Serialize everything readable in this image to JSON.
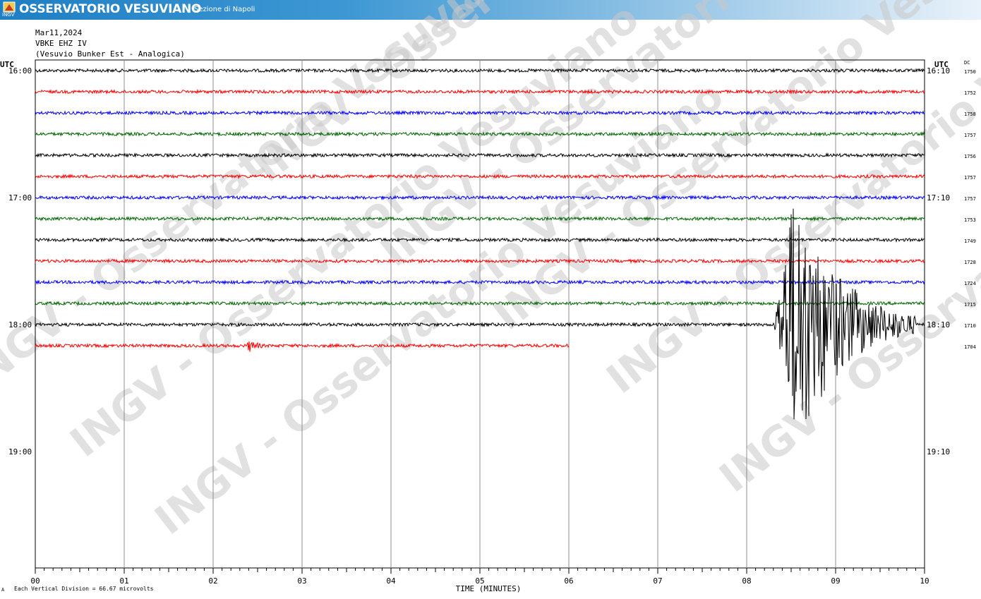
{
  "banner": {
    "org": "OSSERVATORIO VESUVIANO",
    "section": "Sezione di Napoli",
    "logo_text": "INGV"
  },
  "header": {
    "date": "Mar11,2024",
    "station": "VBKE EHZ IV",
    "site": "(Vesuvio Bunker Est - Analogica)"
  },
  "watermark": "INGV - Osservatorio Vesuviano",
  "footer": {
    "scale_note": "Each Vertical Division =   66.67 microvolts",
    "corner_mark": "A"
  },
  "chart_data": {
    "type": "line",
    "title": "",
    "xlabel": "TIME (MINUTES)",
    "ylabel": "",
    "x_ticks": [
      "00",
      "01",
      "02",
      "03",
      "04",
      "05",
      "06",
      "07",
      "08",
      "09",
      "10"
    ],
    "xlim": [
      0,
      10
    ],
    "left_axis_label": "UTC",
    "right_axis_label": "UTC",
    "dc_label": "DC",
    "left_time_labels": [
      {
        "row": 0,
        "text": "16:00"
      },
      {
        "row": 6,
        "text": "17:00"
      },
      {
        "row": 12,
        "text": "18:00"
      },
      {
        "row": 18,
        "text": "19:00"
      }
    ],
    "right_time_labels": [
      {
        "row": 0,
        "text": "16:10"
      },
      {
        "row": 6,
        "text": "17:10"
      },
      {
        "row": 12,
        "text": "18:10"
      },
      {
        "row": 18,
        "text": "19:10"
      }
    ],
    "row_minutes": 10,
    "total_rows": 24,
    "series_colors": [
      "#000000",
      "#ff0000",
      "#0000ff",
      "#006600"
    ],
    "traces": [
      {
        "dc": "1750",
        "end_min": 10
      },
      {
        "dc": "1752",
        "end_min": 10
      },
      {
        "dc": "1758",
        "end_min": 10
      },
      {
        "dc": "1757",
        "end_min": 10
      },
      {
        "dc": "1756",
        "end_min": 10
      },
      {
        "dc": "1757",
        "end_min": 10
      },
      {
        "dc": "1757",
        "end_min": 10
      },
      {
        "dc": "1753",
        "end_min": 10
      },
      {
        "dc": "1749",
        "end_min": 10
      },
      {
        "dc": "1728",
        "end_min": 10
      },
      {
        "dc": "1724",
        "end_min": 10
      },
      {
        "dc": "1715",
        "end_min": 10
      },
      {
        "dc": "1710",
        "end_min": 10
      },
      {
        "dc": "1704",
        "end_min": 6
      }
    ],
    "events": [
      {
        "trace": 13,
        "start_min": 2.35,
        "end_min": 2.75,
        "amplitude_divisions": 0.3
      },
      {
        "trace": 12,
        "start_min": 8.3,
        "end_min": 9.9,
        "amplitude_divisions": 6.5
      }
    ]
  }
}
